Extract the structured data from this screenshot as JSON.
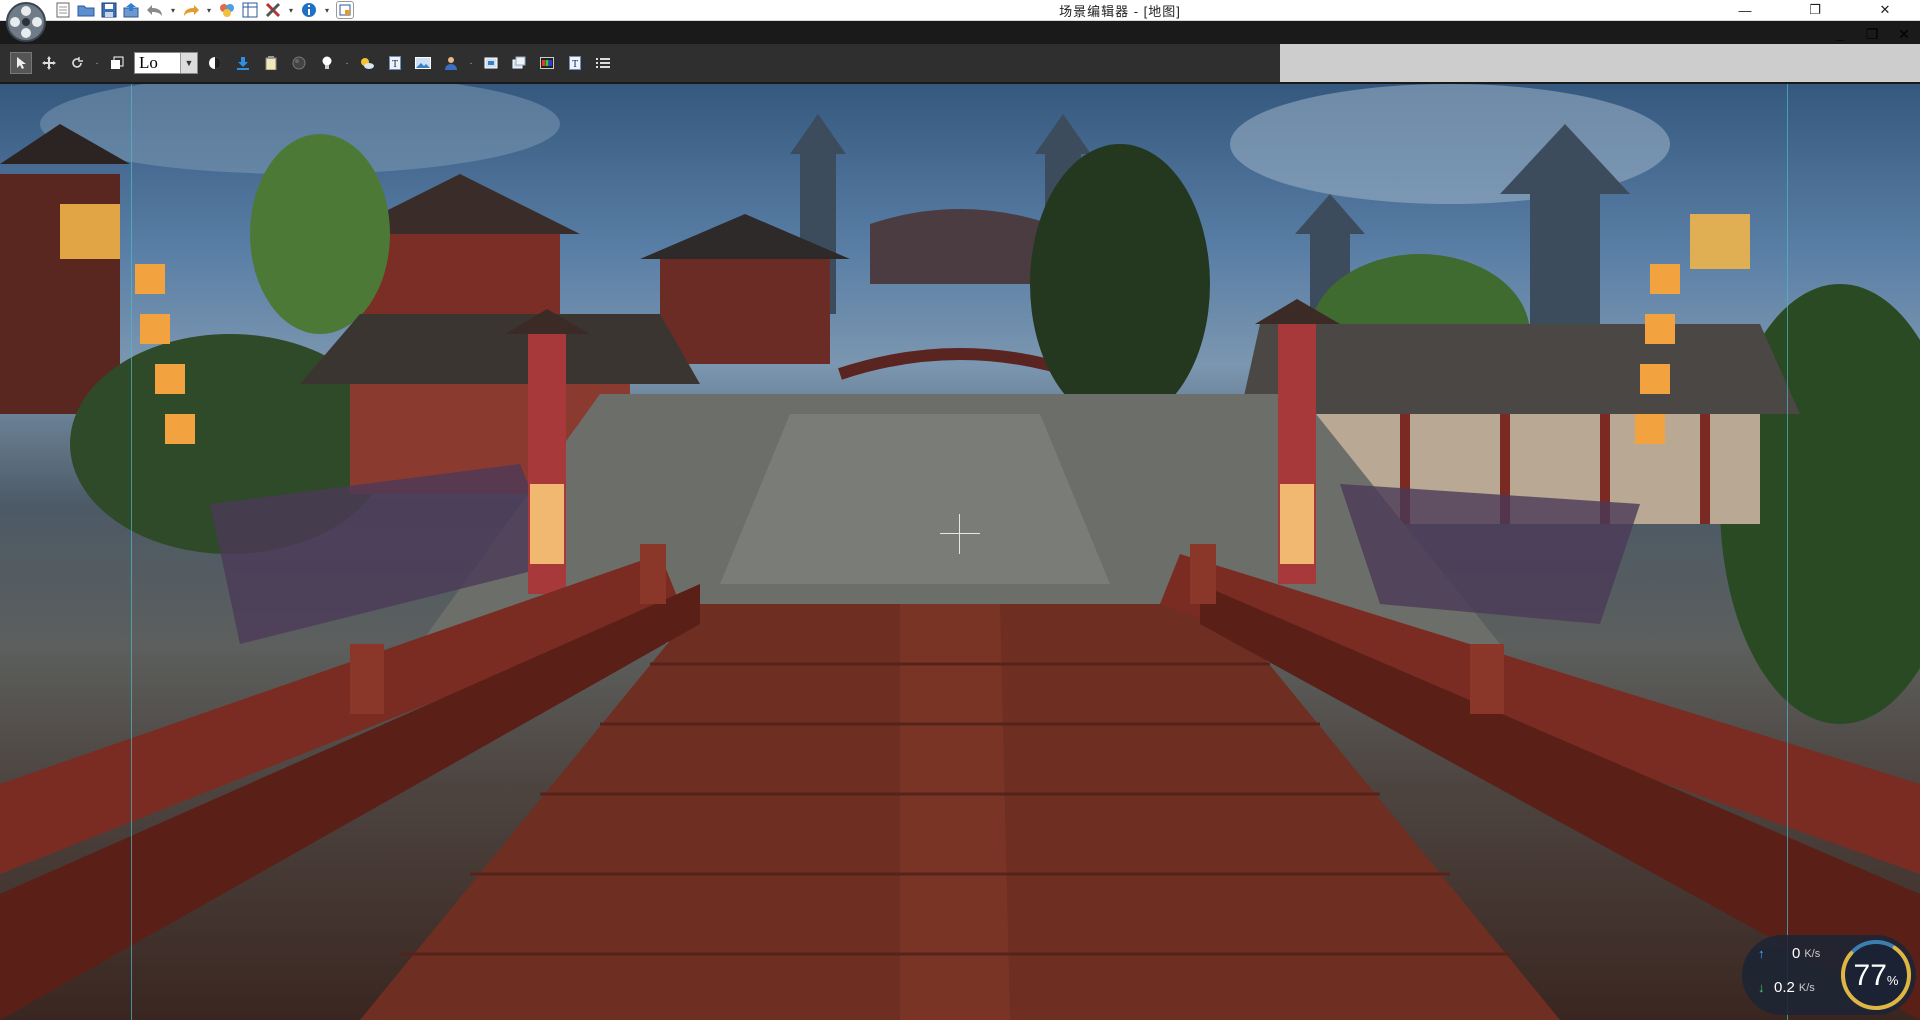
{
  "window": {
    "title": "场景编辑器 - [地图]",
    "controls": [
      "—",
      "❐",
      "✕"
    ]
  },
  "quick_access": {
    "icons": [
      "film-reel-logo",
      "new-file-icon",
      "open-folder-icon",
      "save-icon",
      "export-icon",
      "undo-icon",
      "redo-icon",
      "objects-icon",
      "table-icon",
      "tools-icon",
      "info-icon",
      "layout-icon"
    ]
  },
  "toolbar": {
    "quality_value": "Lo",
    "icons": [
      "select-arrow-icon",
      "move-icon",
      "rotate-icon",
      "layer-icon",
      "contrast-icon",
      "download-icon",
      "clipboard-icon",
      "sphere-icon",
      "light-bulb-icon",
      "weather-icon",
      "text-box-icon",
      "image-icon",
      "person-icon",
      "frame-icon",
      "window-icon",
      "palette-icon",
      "text-icon",
      "list-icon"
    ]
  },
  "mdi_controls": [
    "_",
    "❐",
    "✕"
  ],
  "net_widget": {
    "upload_value": "0",
    "upload_unit": "K/s",
    "download_value": "0.2",
    "download_unit": "K/s",
    "gauge_value": "77",
    "gauge_unit": "%",
    "gauge_fraction": 0.77
  },
  "colors": {
    "toolbar_bg": "#2f2f2f",
    "guide_line": "#4fb9c6",
    "gauge_accent": "#e0b640",
    "gauge_track": "#3b7fb0"
  }
}
